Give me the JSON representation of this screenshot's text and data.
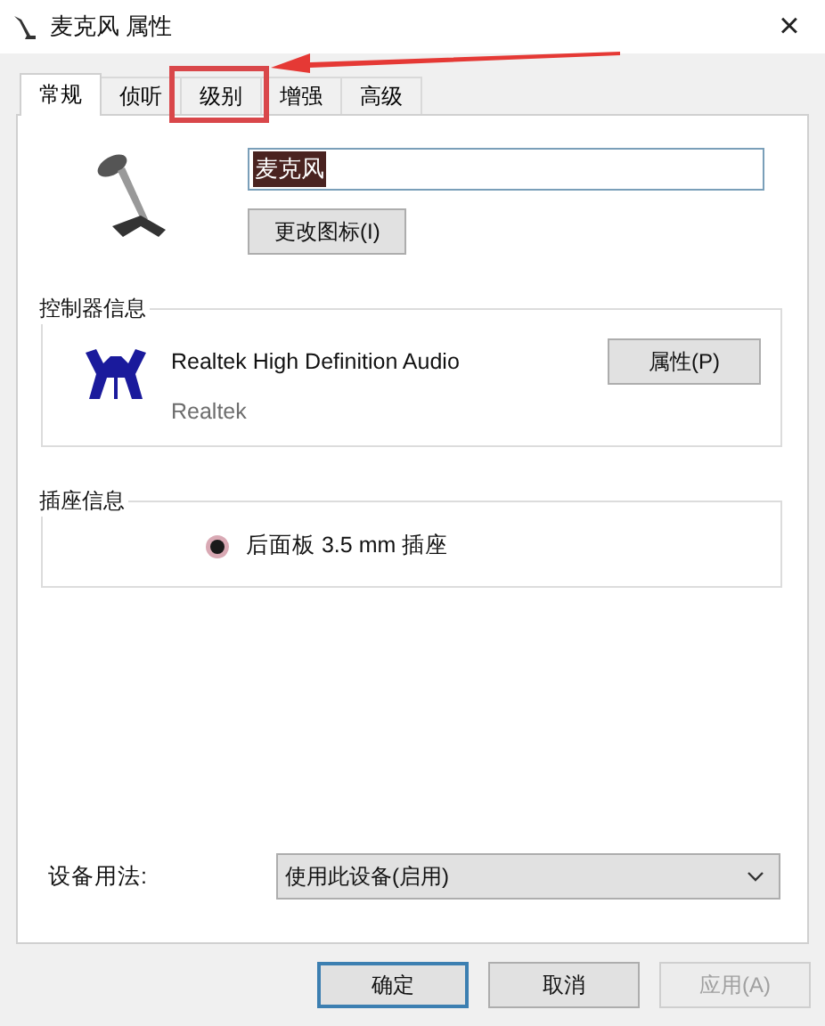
{
  "window": {
    "title": "麦克风 属性",
    "close": "×"
  },
  "tabs": [
    {
      "label": "常规",
      "selected": true
    },
    {
      "label": "侦听",
      "selected": false
    },
    {
      "label": "级别",
      "selected": false,
      "highlighted": true
    },
    {
      "label": "增强",
      "selected": false
    },
    {
      "label": "高级",
      "selected": false
    }
  ],
  "general": {
    "name_field": {
      "value": "麦克风",
      "text_selected": true
    },
    "change_icon_button": "更改图标(I)"
  },
  "controller": {
    "legend": "控制器信息",
    "device": "Realtek High Definition Audio",
    "vendor": "Realtek",
    "button": "属性(P)"
  },
  "jack": {
    "legend": "插座信息",
    "text": "后面板 3.5 mm 插座"
  },
  "usage": {
    "label": "设备用法:",
    "value": "使用此设备(启用)"
  },
  "buttons": [
    {
      "label": "确定",
      "default": true,
      "disabled": false
    },
    {
      "label": "取消",
      "default": false,
      "disabled": false
    },
    {
      "label": "应用(A)",
      "default": false,
      "disabled": true
    }
  ]
}
